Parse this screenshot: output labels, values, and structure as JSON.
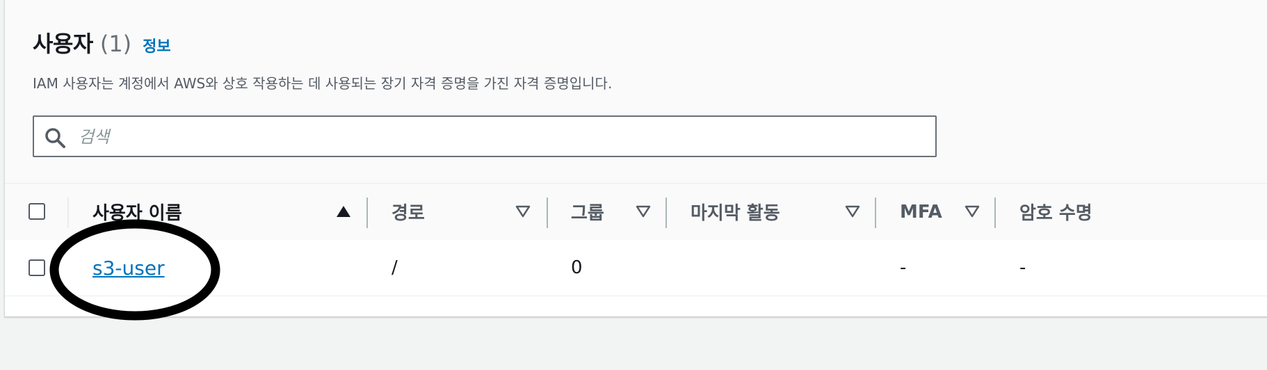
{
  "section": {
    "title": "사용자",
    "count": "(1)",
    "info_link": "정보",
    "description": "IAM 사용자는 계정에서 AWS와 상호 작용하는 데 사용되는 장기 자격 증명을 가진 자격 증명입니다."
  },
  "search": {
    "placeholder": "검색",
    "value": "",
    "icon": "search-icon"
  },
  "table": {
    "columns": [
      {
        "label": "사용자 이름",
        "sort": "ascending"
      },
      {
        "label": "경로",
        "sort": "none"
      },
      {
        "label": "그룹",
        "sort": "none"
      },
      {
        "label": "마지막 활동",
        "sort": "none"
      },
      {
        "label": "MFA",
        "sort": "none"
      },
      {
        "label": "암호 수명",
        "sort": "none"
      }
    ],
    "rows": [
      {
        "user_name": "s3-user",
        "path": "/",
        "groups": "0",
        "last_activity": "",
        "mfa": "-",
        "password_age": "-"
      }
    ]
  },
  "colors": {
    "link": "#0073bb",
    "header_bg": "#fafafa",
    "page_bg": "#f2f3f3",
    "annotation": "#000000"
  }
}
